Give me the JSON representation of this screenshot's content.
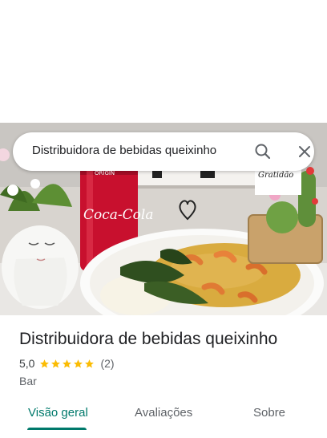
{
  "search": {
    "query": "Distribuidora de bebidas queixinho"
  },
  "hero": {
    "can_brand_text": "Coca-Cola",
    "can_top_text": "ORIGIN",
    "sign_text": "Gratidão"
  },
  "place": {
    "title": "Distribuidora de bebidas queixinho",
    "rating": "5,0",
    "stars": 5,
    "review_count": "(2)",
    "category": "Bar"
  },
  "tabs": [
    {
      "label": "Visão geral",
      "active": true
    },
    {
      "label": "Avaliações",
      "active": false
    },
    {
      "label": "Sobre",
      "active": false
    }
  ],
  "colors": {
    "accent": "#00796b",
    "star": "#fbbc04",
    "can_red": "#c8102e"
  }
}
